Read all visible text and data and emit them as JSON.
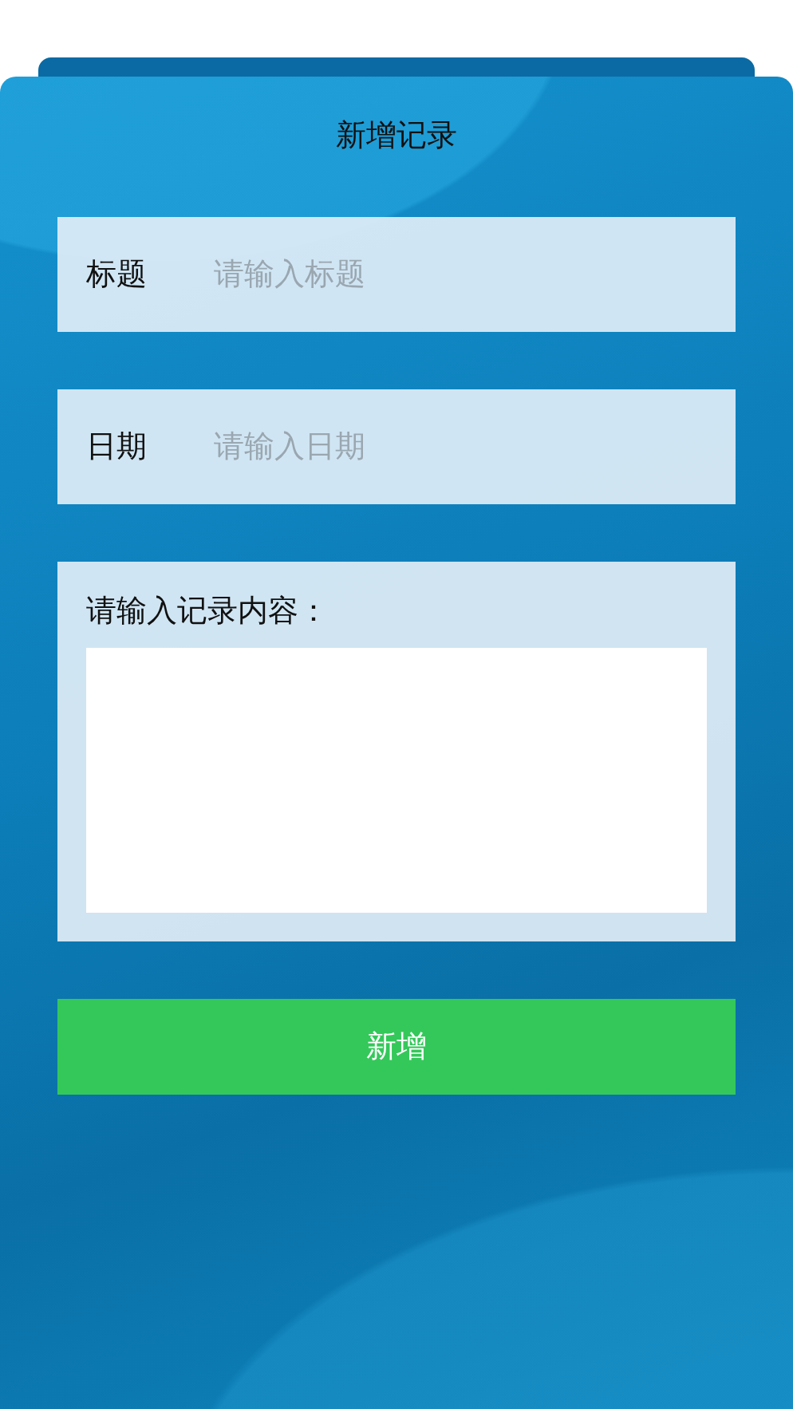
{
  "title": "新增记录",
  "fields": [
    {
      "label": "标题",
      "placeholder": "请输入标题"
    },
    {
      "label": "日期",
      "placeholder": "请输入日期"
    }
  ],
  "content": {
    "label": "请输入记录内容："
  },
  "submit": "新增"
}
